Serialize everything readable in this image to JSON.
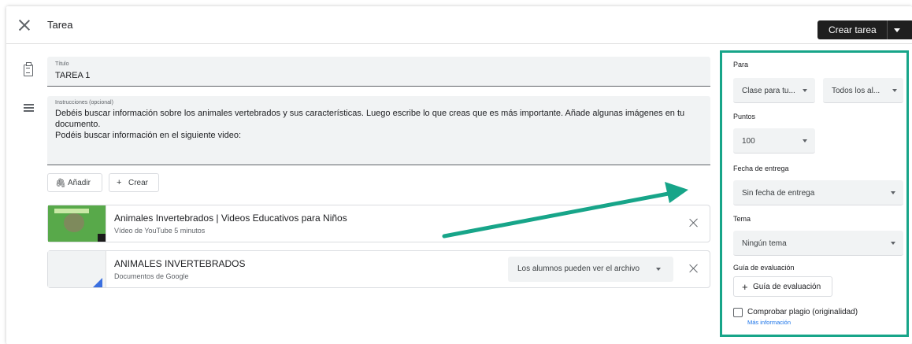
{
  "header": {
    "title": "Tarea",
    "create_label": "Crear tarea"
  },
  "form": {
    "title_label": "Título",
    "title_value": "TAREA 1",
    "instructions_label": "Instrucciones (opcional)",
    "instructions_line1": "Debéis buscar información sobre los animales vertebrados y sus características. Luego escribe lo que creas que es más importante. Añade algunas imágenes en tu",
    "instructions_line2": "documento.",
    "instructions_line3": "Podéis buscar información en el siguiente video:",
    "add_label": "Añadir",
    "create_label": "Crear"
  },
  "attachments": [
    {
      "title": "Animales Invertebrados | Videos Educativos para Niños",
      "subtitle": "Vídeo de YouTube  5 minutos"
    },
    {
      "title": "ANIMALES INVERTEBRADOS",
      "subtitle": "Documentos de Google",
      "permission": "Los alumnos pueden ver el archivo"
    }
  ],
  "panel": {
    "for_label": "Para",
    "class_value": "Clase para tu...",
    "students_value": "Todos los al...",
    "points_label": "Puntos",
    "points_value": "100",
    "due_label": "Fecha de entrega",
    "due_value": "Sin fecha de entrega",
    "topic_label": "Tema",
    "topic_value": "Ningún tema",
    "rubric_label": "Guía de evaluación",
    "rubric_button": "Guía de evaluación",
    "plagiarism_label": "Comprobar plagio (originalidad)",
    "more_info": "Más información"
  },
  "colors": {
    "highlight": "#17a589",
    "primary_dark": "#1f1f1f"
  }
}
